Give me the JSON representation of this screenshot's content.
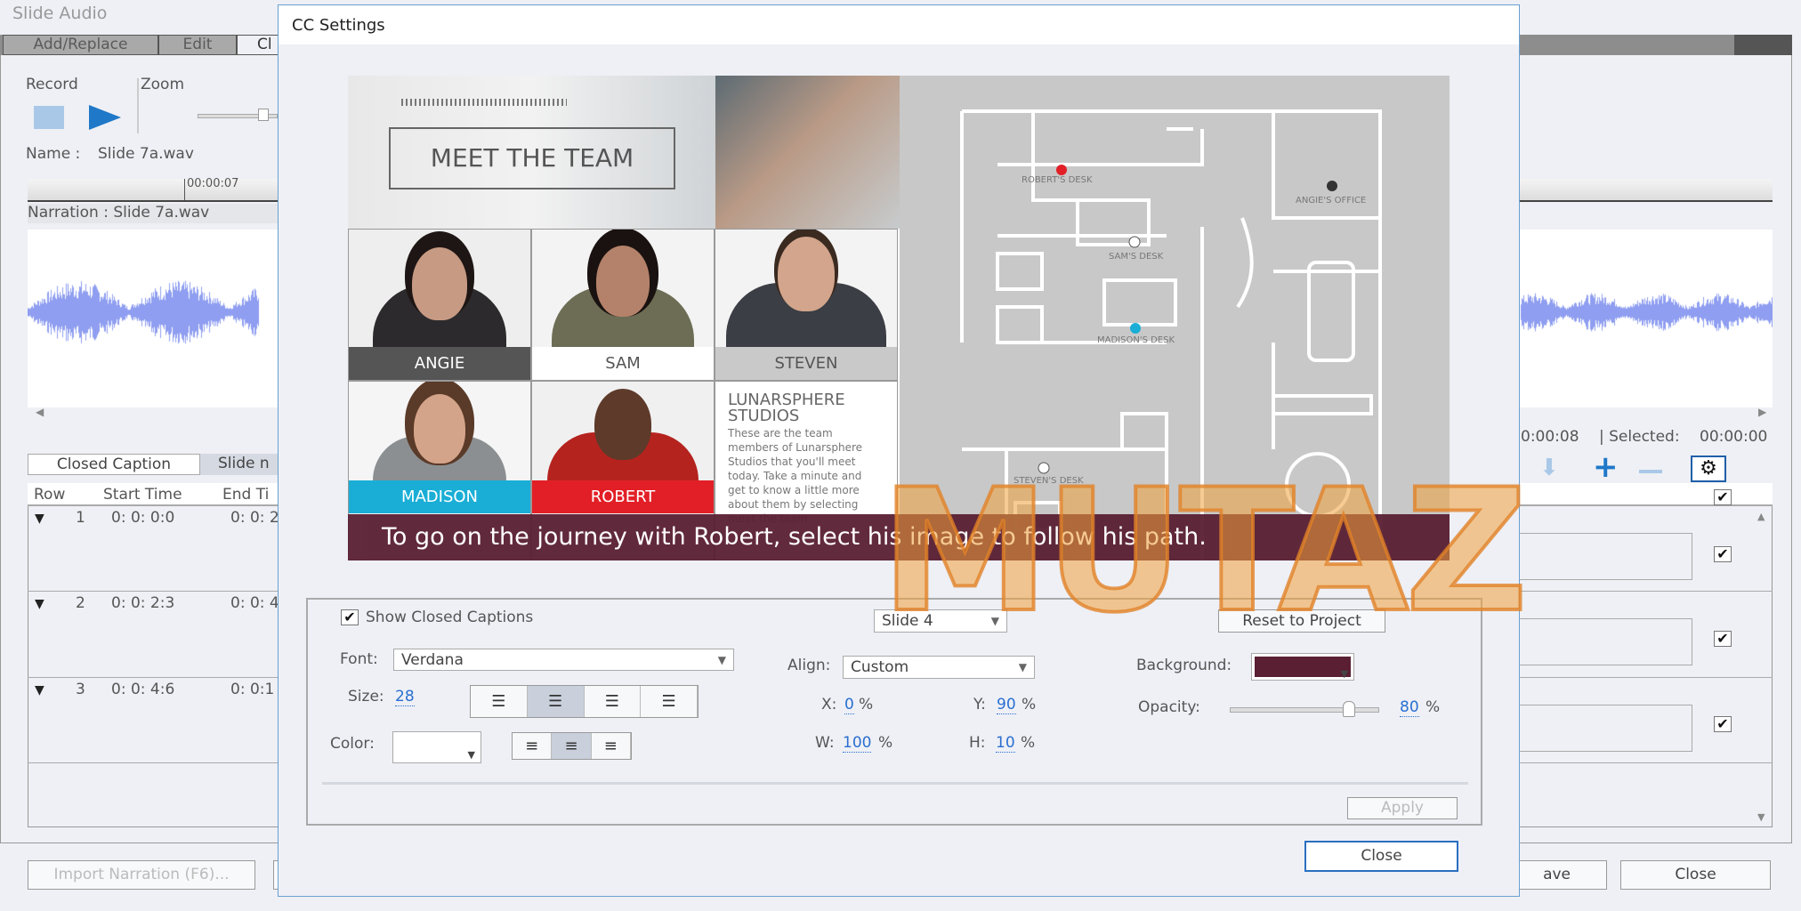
{
  "window": {
    "title": "Slide Audio"
  },
  "tabs": [
    {
      "label": "Add/Replace"
    },
    {
      "label": "Edit"
    },
    {
      "label": "Cl"
    }
  ],
  "record": {
    "label": "Record",
    "zoom_label": "Zoom",
    "name_label": "Name :",
    "name_value": "Slide 7a.wav",
    "ruler_time": "00:00:07",
    "narration_label": "Narration : Slide 7a.wav"
  },
  "status": {
    "duration": "0:00:08",
    "selected_label": "| Selected:",
    "selected_value": "00:00:00"
  },
  "lower_tabs": [
    {
      "label": "Closed Caption"
    },
    {
      "label": "Slide n"
    }
  ],
  "table": {
    "headers": [
      "Row",
      "Start Time",
      "End Ti"
    ],
    "rows": [
      {
        "row": "1",
        "start": "0: 0: 0:0",
        "end": "0: 0: 2",
        "checked": true
      },
      {
        "row": "2",
        "start": "0: 0: 2:3",
        "end": "0: 0: 4",
        "checked": true
      },
      {
        "row": "3",
        "start": "0: 0: 4:6",
        "end": "0: 0:1",
        "checked": true
      }
    ]
  },
  "footer": {
    "import": "Import Narration (F6)...",
    "save": "ave",
    "close": "Close"
  },
  "dialog": {
    "title": "CC Settings",
    "slide": {
      "banner": "MEET THE TEAM",
      "people": [
        {
          "name": "ANGIE"
        },
        {
          "name": "SAM"
        },
        {
          "name": "STEVEN"
        },
        {
          "name": "MADISON"
        },
        {
          "name": "ROBERT"
        }
      ],
      "studio_title": "LUNARSPHERE STUDIOS",
      "studio_text": "These are the team members of Lunarsphere Studios that you'll meet today. Take a minute and get to know a little more about them by selecting meet the team",
      "map_labels": [
        "ROBERT'S DESK",
        "ANGIE'S OFFICE",
        "SAM'S DESK",
        "MADISON'S DESK",
        "STEVEN'S DESK"
      ],
      "caption": "To go on the journey with Robert, select his image to follow his path.",
      "caption_bg": "#5a1f33"
    },
    "show_cc_label": "Show Closed Captions",
    "show_cc_checked": true,
    "slide_select": "Slide 4",
    "reset_label": "Reset to Project",
    "font_label": "Font:",
    "font_value": "Verdana",
    "align_label": "Align:",
    "align_value": "Custom",
    "background_label": "Background:",
    "background_color": "#5a1f33",
    "size_label": "Size:",
    "size_value": "28",
    "x_label": "X:",
    "x_value": "0",
    "y_label": "Y:",
    "y_value": "90",
    "w_label": "W:",
    "w_value": "100",
    "h_label": "H:",
    "h_value": "10",
    "pct": "%",
    "opacity_label": "Opacity:",
    "opacity_value": "80",
    "color_label": "Color:",
    "color_value": "#ffffff",
    "apply_label": "Apply",
    "close_label": "Close"
  },
  "watermark": "MUTAZ"
}
